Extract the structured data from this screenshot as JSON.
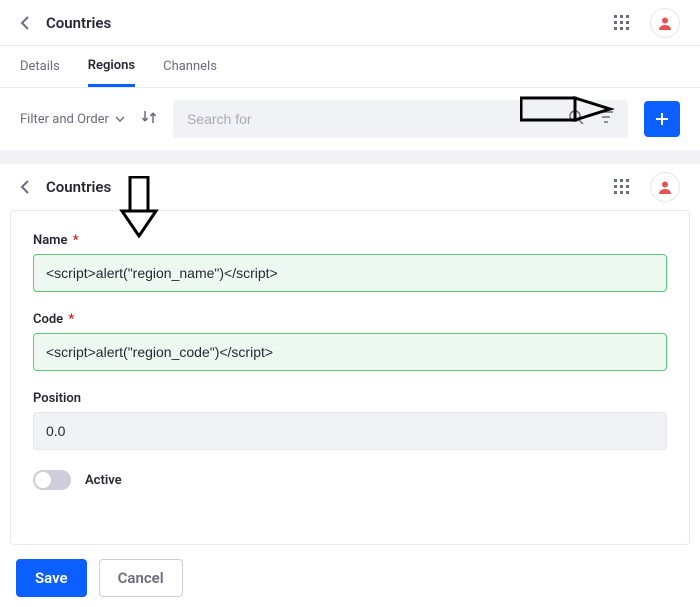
{
  "header1": {
    "title": "Countries"
  },
  "tabs": {
    "items": [
      "Details",
      "Regions",
      "Channels"
    ],
    "active_index": 1
  },
  "filter": {
    "label": "Filter and Order"
  },
  "search": {
    "placeholder": "Search for"
  },
  "header2": {
    "title": "Countries"
  },
  "form": {
    "name_label": "Name",
    "name_value": "<script>alert(\"region_name\")</script>",
    "code_label": "Code",
    "code_value": "<script>alert(\"region_code\")</script>",
    "position_label": "Position",
    "position_value": "0.0",
    "active_label": "Active"
  },
  "actions": {
    "save": "Save",
    "cancel": "Cancel"
  }
}
